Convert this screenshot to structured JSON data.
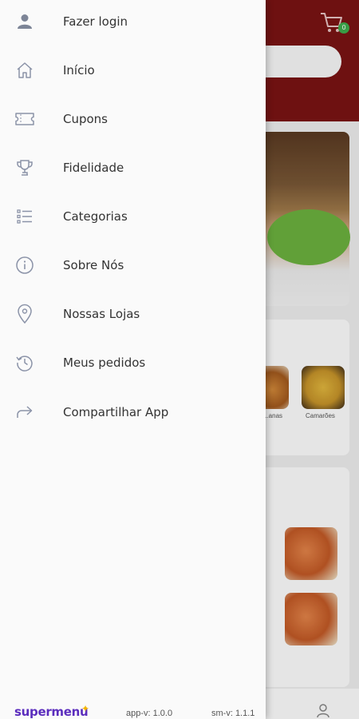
{
  "drawer": {
    "items": [
      {
        "label": "Fazer login",
        "icon": "user-icon"
      },
      {
        "label": "Início",
        "icon": "home-icon"
      },
      {
        "label": "Cupons",
        "icon": "ticket-icon"
      },
      {
        "label": "Fidelidade",
        "icon": "trophy-icon"
      },
      {
        "label": "Categorias",
        "icon": "list-icon"
      },
      {
        "label": "Sobre Nós",
        "icon": "info-icon"
      },
      {
        "label": "Nossas Lojas",
        "icon": "location-pin-icon"
      },
      {
        "label": "Meus pedidos",
        "icon": "history-icon"
      },
      {
        "label": "Compartilhar App",
        "icon": "share-icon"
      }
    ],
    "footer": {
      "brand": "supermenu",
      "app_version": "app-v: 1.0.0",
      "sm_version": "sm-v: 1.1.1"
    }
  },
  "background": {
    "cart_badge": "0",
    "categories": [
      {
        "label": "...anas"
      },
      {
        "label": "Camarões"
      }
    ]
  },
  "colors": {
    "header": "#7b1414",
    "brand": "#5b2dbd",
    "badge": "#3fae4d",
    "icon": "#8b93a8"
  }
}
